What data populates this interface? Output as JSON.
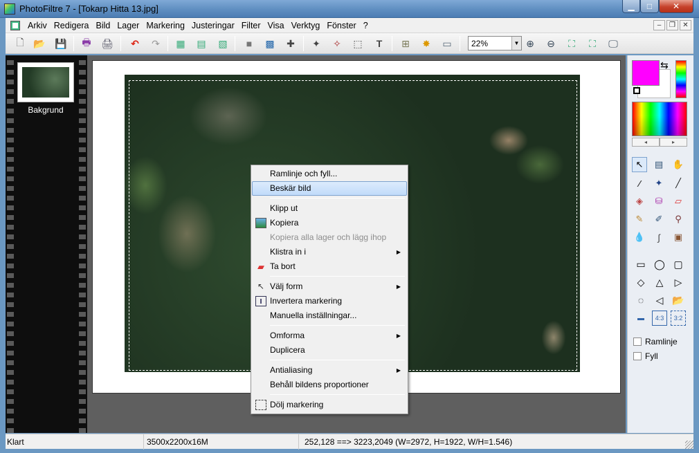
{
  "window": {
    "title": "PhotoFiltre 7 - [Tokarp Hitta 13.jpg]",
    "min_glyph": "▁",
    "max_glyph": "□",
    "close_glyph": "✕"
  },
  "menubar": {
    "items": [
      "Arkiv",
      "Redigera",
      "Bild",
      "Lager",
      "Markering",
      "Justeringar",
      "Filter",
      "Visa",
      "Verktyg",
      "Fönster",
      "?"
    ],
    "mdi_min": "–",
    "mdi_restore": "❐",
    "mdi_close": "✕"
  },
  "toolbar": {
    "zoom_value": "22%",
    "zoom_arrow": "▼",
    "icons": [
      "new-file-icon",
      "open-folder-icon",
      "save-icon",
      "print-icon",
      "scan-icon",
      "undo-icon",
      "redo-icon",
      "image-a-icon",
      "image-b-icon",
      "image-c-icon",
      "gray-square-icon",
      "color-grid-icon",
      "figure-icon",
      "figure-b-icon",
      "figure-c-icon",
      "selection-icon",
      "text-tool-icon",
      "tree-icon",
      "puzzle-icon",
      "window-icon",
      "zoom-in-icon",
      "zoom-out-icon",
      "fit-icon",
      "fit-b-icon",
      "monitor-icon"
    ],
    "glyphs": [
      "🗋",
      "📂",
      "💾",
      "🖶",
      "🖨",
      "↶",
      "↷",
      "▦",
      "▤",
      "▧",
      "■",
      "▩",
      "✚",
      "✦",
      "✧",
      "⬚",
      "T",
      "⊞",
      "✸",
      "▭",
      "⊕",
      "⊖",
      "⛶",
      "⛶",
      "🖵"
    ]
  },
  "layers": {
    "name": "Bakgrund"
  },
  "context_menu": {
    "items": [
      {
        "label": "Ramlinje och fyll...",
        "submenu": false,
        "enabled": true
      },
      {
        "label": "Beskär bild",
        "submenu": false,
        "enabled": true,
        "selected": true
      },
      {
        "label": "Klipp ut",
        "submenu": false,
        "enabled": true
      },
      {
        "label": "Kopiera",
        "submenu": false,
        "enabled": true,
        "icon": "copy-image-icon"
      },
      {
        "label": "Kopiera alla lager och lägg ihop",
        "submenu": false,
        "enabled": false
      },
      {
        "label": "Klistra in i",
        "submenu": true,
        "enabled": true
      },
      {
        "label": "Ta bort",
        "submenu": false,
        "enabled": true,
        "icon": "eraser-icon"
      },
      {
        "label": "Välj form",
        "submenu": true,
        "enabled": true,
        "icon": "cursor-icon"
      },
      {
        "label": "Invertera markering",
        "submenu": false,
        "enabled": true,
        "icon": "invert-icon"
      },
      {
        "label": "Manuella inställningar...",
        "submenu": false,
        "enabled": true
      },
      {
        "label": "Omforma",
        "submenu": true,
        "enabled": true
      },
      {
        "label": "Duplicera",
        "submenu": false,
        "enabled": true
      },
      {
        "label": "Antialiasing",
        "submenu": true,
        "enabled": true
      },
      {
        "label": "Behåll bildens proportioner",
        "submenu": false,
        "enabled": true
      },
      {
        "label": "Dölj markering",
        "submenu": false,
        "enabled": true,
        "icon": "hide-selection-icon"
      }
    ],
    "submenu_arrow": "▶"
  },
  "right_panel": {
    "foreground_color": "#ff00ff",
    "background_color": "#ffffff",
    "swap_glyph": "⇆",
    "palette_prev": "◂",
    "palette_next": "▸",
    "tools": [
      {
        "name": "pointer-tool-icon",
        "glyph": "↖",
        "active": true
      },
      {
        "name": "selection-tool-icon",
        "glyph": "▤"
      },
      {
        "name": "hand-tool-icon",
        "glyph": "✋"
      },
      {
        "name": "eyedropper-tool-icon",
        "glyph": "⁄"
      },
      {
        "name": "magic-wand-tool-icon",
        "glyph": "✦"
      },
      {
        "name": "line-tool-icon",
        "glyph": "╱"
      },
      {
        "name": "fill-tool-icon",
        "glyph": "◈"
      },
      {
        "name": "spray-tool-icon",
        "glyph": "⛁"
      },
      {
        "name": "eraser-tool-icon",
        "glyph": "▱"
      },
      {
        "name": "brush-tool-icon",
        "glyph": "✎"
      },
      {
        "name": "advanced-brush-tool-icon",
        "glyph": "✐"
      },
      {
        "name": "stamp-tool-icon",
        "glyph": "⚲"
      },
      {
        "name": "blur-tool-icon",
        "glyph": "💧"
      },
      {
        "name": "smudge-tool-icon",
        "glyph": "∫"
      },
      {
        "name": "clone-tool-icon",
        "glyph": "▣"
      }
    ],
    "shapes": [
      {
        "name": "rectangle-shape-icon",
        "glyph": "▭"
      },
      {
        "name": "ellipse-shape-icon",
        "glyph": "◯"
      },
      {
        "name": "rounded-rect-shape-icon",
        "glyph": "▢"
      },
      {
        "name": "diamond-shape-icon",
        "glyph": "◇"
      },
      {
        "name": "triangle-shape-icon",
        "glyph": "△"
      },
      {
        "name": "right-triangle-shape-icon",
        "glyph": "▷"
      },
      {
        "name": "lasso-shape-icon",
        "glyph": "◌"
      },
      {
        "name": "polygon-shape-icon",
        "glyph": "◁"
      },
      {
        "name": "open-shape-icon",
        "glyph": "📂"
      },
      {
        "name": "aspect-free-icon",
        "glyph": "▬"
      },
      {
        "name": "aspect-43-icon",
        "glyph": "4:3"
      },
      {
        "name": "aspect-32-icon",
        "glyph": "3:2"
      }
    ],
    "outline_label": "Ramlinje",
    "fill_label": "Fyll"
  },
  "statusbar": {
    "status": "Klart",
    "image_size": "3500x2200x16M",
    "selection_info": "252,128 ==> 3223,2049 (W=2972, H=1922, W/H=1.546)"
  }
}
